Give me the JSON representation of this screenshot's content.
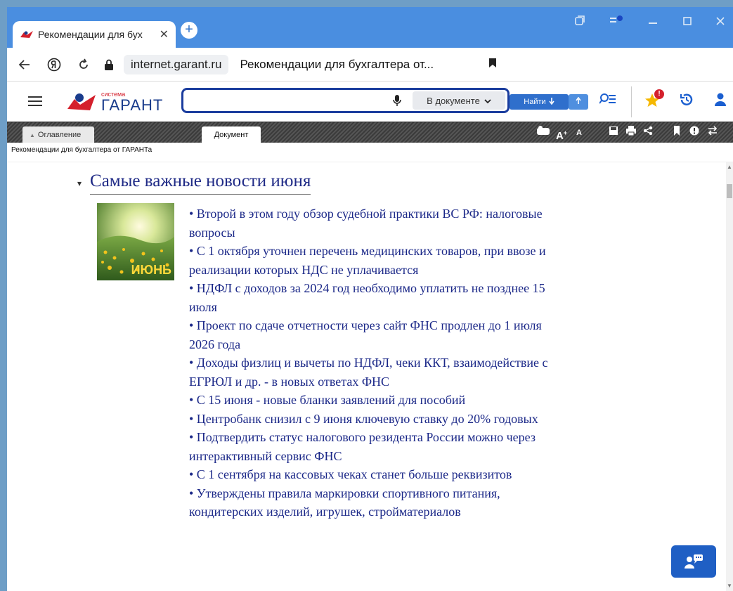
{
  "browser": {
    "tab_title": "Рекомендации для бух",
    "tab_close": "✕",
    "new_tab": "+",
    "url_host": "internet.garant.ru",
    "page_title": "Рекомендации для бухгалтера от...",
    "colors": {
      "frame": "#4a8ee0",
      "tab_bg": "#ffffff"
    }
  },
  "garant": {
    "logo_small": "система",
    "logo_name": "ГАРАНТ",
    "search_value": "",
    "scope_label": "В документе",
    "find_label": "Найти",
    "favorites_badge": "!",
    "colors": {
      "accent": "#1b3d9e",
      "brand_red": "#d4202c",
      "find_button": "#2f6fcc"
    }
  },
  "doc_tabs": {
    "toc": "Оглавление",
    "document": "Документ"
  },
  "doc_toolbar": {
    "font_larger": "A",
    "font_smaller": "A"
  },
  "breadcrumb": "Рекомендации для бухгалтера от ГАРАНТа",
  "content": {
    "heading": "Самые важные новости июня",
    "thumb_label": "ИЮНЬ",
    "news": [
      "• Второй в этом году обзор судебной практики ВС РФ: налоговые вопросы",
      "• С 1 октября уточнен перечень медицинских товаров, при ввозе и реализации которых НДС не уплачивается",
      "• НДФЛ с доходов за 2024 год необходимо уплатить не позднее 15 июля",
      "• Проект по сдаче отчетности через сайт ФНС продлен до 1 июля 2026 года",
      "• Доходы физлиц и вычеты по НДФЛ, чеки ККТ, взаимодействие с ЕГРЮЛ и др. - в новых ответах ФНС",
      "• С 15 июня - новые бланки заявлений для пособий",
      "• Центробанк снизил с 9 июня ключевую ставку до 20% годовых",
      "• Подтвердить статус налогового резидента России можно через интерактивный сервис ФНС",
      "• С 1 сентября на кассовых чеках станет больше реквизитов",
      "• Утверждены правила маркировки спортивного питания, кондитерских изделий, игрушек, стройматериалов"
    ],
    "colors": {
      "link": "#1b2888"
    }
  }
}
